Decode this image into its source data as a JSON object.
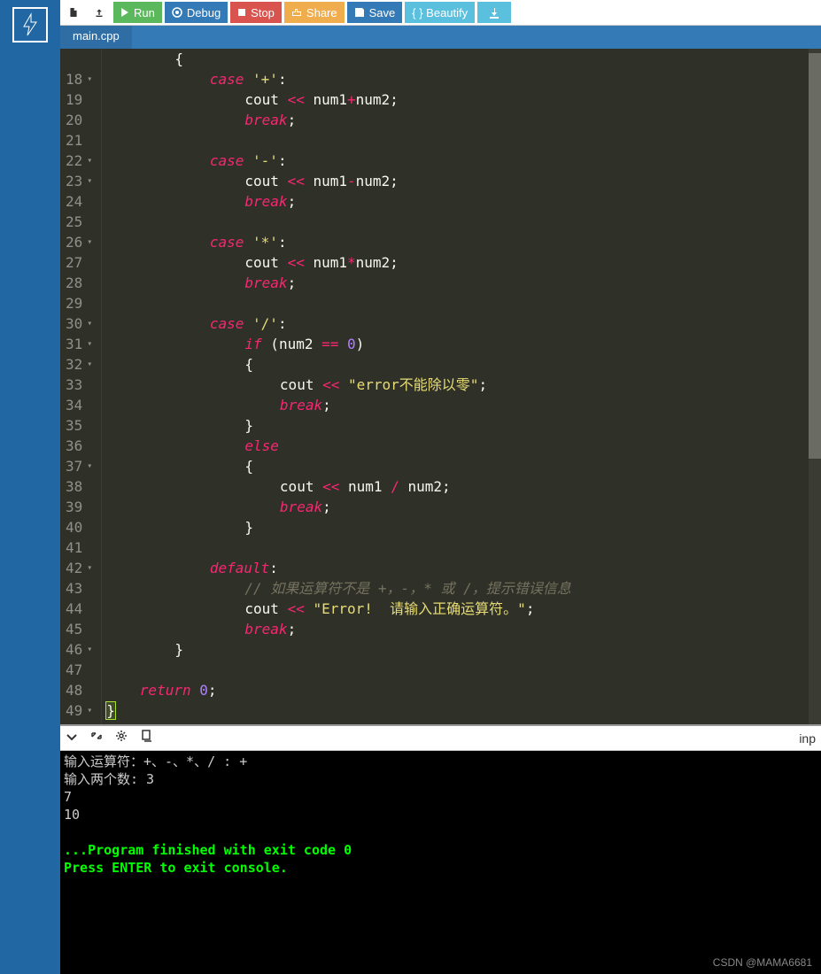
{
  "toolbar": {
    "run": "Run",
    "debug": "Debug",
    "stop": "Stop",
    "share": "Share",
    "save": "Save",
    "beautify": "{ } Beautify"
  },
  "tab": {
    "name": "main.cpp"
  },
  "gutter": {
    "start": 18,
    "end": 49,
    "foldable": [
      18,
      22,
      23,
      26,
      30,
      31,
      32,
      37,
      42,
      46,
      49
    ]
  },
  "code": {
    "l17": "        {",
    "l18": "            case '+':",
    "l19": "                cout << num1+num2;",
    "l20": "                break;",
    "l21": "",
    "l22": "            case '-':",
    "l23": "                cout << num1-num2;",
    "l24": "                break;",
    "l25": "",
    "l26": "            case '*':",
    "l27": "                cout << num1*num2;",
    "l28": "                break;",
    "l29": "",
    "l30": "            case '/':",
    "l31": "                if (num2 == 0)",
    "l32": "                {",
    "l33": "                    cout << \"error不能除以零\";",
    "l34": "                    break;",
    "l35": "                }",
    "l36": "                else",
    "l37": "                {",
    "l38": "                    cout << num1 / num2;",
    "l39": "                    break;",
    "l40": "                }",
    "l41": "",
    "l42": "            default:",
    "l43": "                // 如果运算符不是 +，-，* 或 /，提示错误信息",
    "l44": "                cout << \"Error!  请输入正确运算符。\";",
    "l45": "                break;",
    "l46": "        }",
    "l47": "",
    "l48": "    return 0;",
    "l49": "}"
  },
  "console_tools": {
    "right_label": "inp"
  },
  "console": {
    "line1": "输入运算符：+、-、*、/ : +",
    "line2": "输入两个数: 3",
    "line3": "7",
    "line4": "10",
    "line5": "",
    "line6": "...Program finished with exit code 0",
    "line7": "Press ENTER to exit console."
  },
  "watermark": "CSDN @MAMA6681"
}
